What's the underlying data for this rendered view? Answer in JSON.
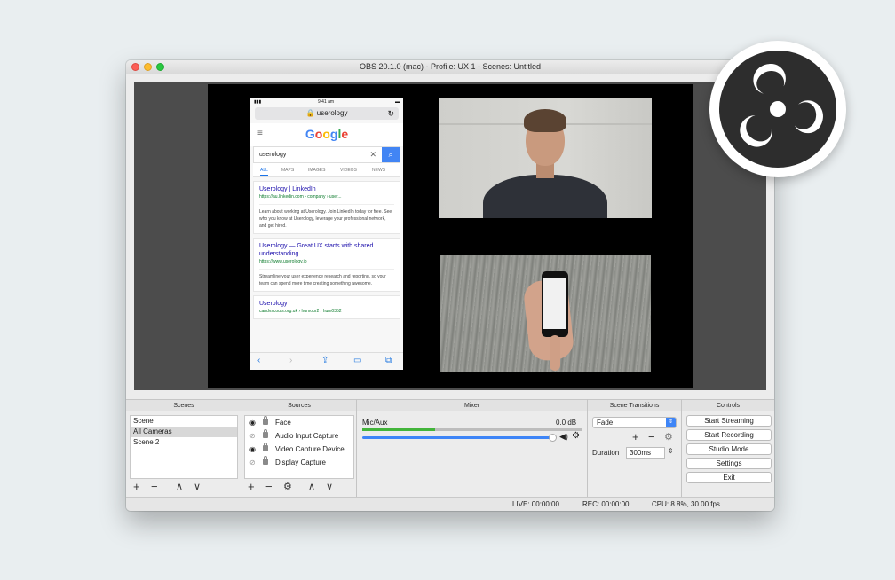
{
  "window": {
    "title": "OBS 20.1.0 (mac) - Profile: UX 1 - Scenes: Untitled"
  },
  "preview": {
    "phone": {
      "time": "9:41 am",
      "url": "userology",
      "google_logo": "Google",
      "search_query": "userology",
      "tabs": [
        "ALL",
        "MAPS",
        "IMAGES",
        "VIDEOS",
        "NEWS"
      ],
      "results": [
        {
          "title": "Userology | LinkedIn",
          "url": "https://au.linkedin.com › company › user...",
          "snippet": "Learn about working at Userology. Join LinkedIn today for free. See who you know at Userology, leverage your professional network, and get hired."
        },
        {
          "title": "Userology — Great UX starts with shared understanding",
          "url": "https://www.userology.io",
          "snippet": "Streamline your user experience research and reporting, so your team can spend more time creating something awesome."
        },
        {
          "title": "Userology",
          "url": "candvscouts.org.uk › humour2 › hum0352",
          "snippet": ""
        }
      ]
    }
  },
  "panels": {
    "scenes": {
      "header": "Scenes",
      "items": [
        "Scene",
        "All Cameras",
        "Scene 2"
      ],
      "selected_index": 1
    },
    "sources": {
      "header": "Sources",
      "items": [
        {
          "label": "Face",
          "visible": true
        },
        {
          "label": "Audio Input Capture",
          "visible": false
        },
        {
          "label": "Video Capture Device",
          "visible": true
        },
        {
          "label": "Display Capture",
          "visible": false
        }
      ]
    },
    "mixer": {
      "header": "Mixer",
      "channel": "Mic/Aux",
      "db": "0.0 dB",
      "level_fraction": 0.33,
      "volume_fraction": 1.0
    },
    "transitions": {
      "header": "Scene Transitions",
      "selected": "Fade",
      "duration_label": "Duration",
      "duration_value": "300ms"
    },
    "controls": {
      "header": "Controls",
      "buttons": [
        "Start Streaming",
        "Start Recording",
        "Studio Mode",
        "Settings",
        "Exit"
      ]
    }
  },
  "status": {
    "live": "LIVE: 00:00:00",
    "rec": "REC: 00:00:00",
    "cpu": "CPU: 8.8%, 30.00 fps"
  },
  "icons": {
    "add": "+",
    "remove": "−",
    "up": "∧",
    "down": "∨",
    "gear": "⚙",
    "eye": "👁",
    "eye_off": "⊘",
    "speaker": "🔊"
  },
  "colors": {
    "accent": "#3e85f7",
    "meter_green": "#43b53b",
    "google_blue": "#4285f4",
    "close": "#fc5f57",
    "minimize": "#fdbc2e",
    "maximize": "#28c840"
  }
}
